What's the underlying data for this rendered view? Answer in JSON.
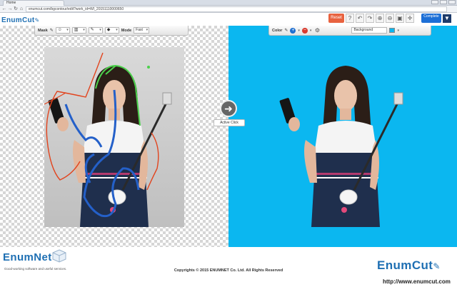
{
  "browser": {
    "tab_title": "Home",
    "url": "enumcut.com/bgcontour/edit?work_id=WI_20151110000650",
    "back_glyph": "←",
    "forward_glyph": "→",
    "reload_glyph": "↻",
    "home_glyph": "⌂"
  },
  "header": {
    "logo": "EnumCut",
    "reset_label": "Reset",
    "complete_label": "Complete",
    "tools": [
      {
        "name": "help-icon",
        "glyph": "?"
      },
      {
        "name": "undo-icon",
        "glyph": "↶"
      },
      {
        "name": "redo-icon",
        "glyph": "↷"
      },
      {
        "name": "zoom-in-icon",
        "glyph": "⊕"
      },
      {
        "name": "zoom-out-icon",
        "glyph": "⊖"
      },
      {
        "name": "fit-screen-icon",
        "glyph": "▣"
      },
      {
        "name": "move-icon",
        "glyph": "✛"
      }
    ],
    "ext_glyph": "▼"
  },
  "mask_toolbar": {
    "label": "Mask",
    "mode_label": "Mode",
    "mode_value": "Fast",
    "person_glyph": "☺",
    "eraser_glyph": "▥",
    "brush_glyph": "✎",
    "fill_glyph": "◆",
    "caret": "▾"
  },
  "color_toolbar": {
    "label": "Color",
    "background_label": "Background",
    "background_color": "#0bb7f0",
    "plus_glyph": "+",
    "minus_glyph": "−",
    "gear_glyph": "⚙",
    "caret": "▾"
  },
  "canvas": {
    "active_label": "Active Click",
    "arrow_glyph": "➜"
  },
  "footer": {
    "logo_left": "EnumNet",
    "tagline": "Good-working  software and useful services.",
    "copyright": "Copyrights © 2015 ENUMNET Co. Ltd. All Rights Reserved",
    "logo_right": "EnumCut",
    "url": "http://www.enumcut.com"
  },
  "colors": {
    "accent": "#1e6fb3",
    "reset": "#e8623f",
    "complete": "#1d6fd6",
    "background_swatch": "#0bb7f0"
  }
}
